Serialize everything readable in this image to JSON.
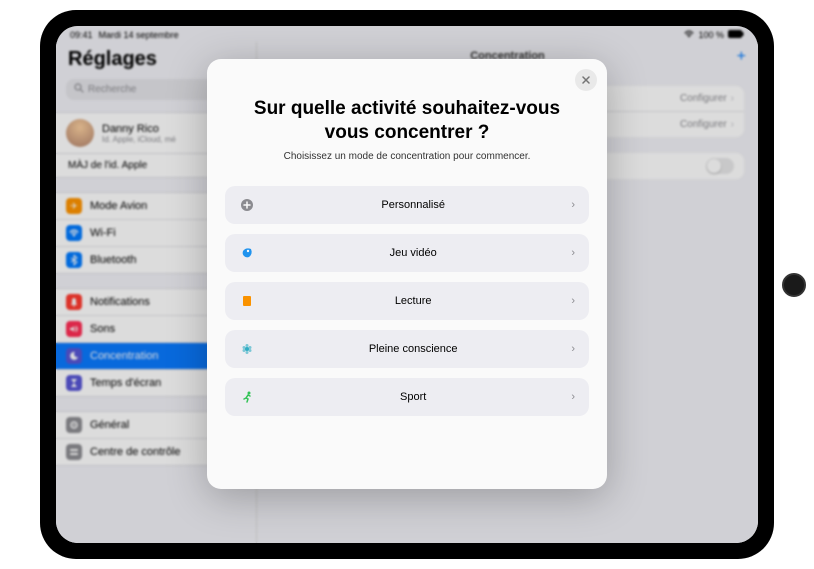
{
  "status": {
    "time": "09:41",
    "date": "Mardi 14 septembre",
    "battery": "100 %"
  },
  "sidebar": {
    "title": "Réglages",
    "search_placeholder": "Recherche",
    "account": {
      "name": "Danny Rico",
      "sub": "Id. Apple, iCloud, mé",
      "update": "MÀJ de l'id. Apple"
    },
    "items": {
      "airplane": "Mode Avion",
      "wifi": "Wi-Fi",
      "bluetooth": "Bluetooth",
      "notifications": "Notifications",
      "sounds": "Sons",
      "focus": "Concentration",
      "screentime": "Temps d'écran",
      "general": "Général",
      "control": "Centre de contrôle"
    }
  },
  "main": {
    "title": "Concentration",
    "configure": "Configurer"
  },
  "modal": {
    "title": "Sur quelle activité souhaitez-vous vous concentrer ?",
    "sub": "Choisissez un mode de concentration pour commencer.",
    "options": {
      "custom": "Personnalisé",
      "gaming": "Jeu vidéo",
      "reading": "Lecture",
      "mindfulness": "Pleine conscience",
      "fitness": "Sport"
    }
  }
}
